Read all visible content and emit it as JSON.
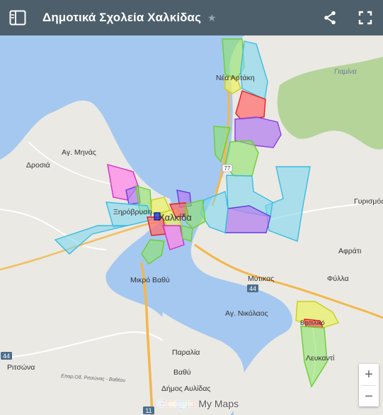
{
  "header": {
    "title": "Δημοτικά Σχολεία Χαλκίδας",
    "menu_icon": "side-panel-icon",
    "star_icon": "star-icon",
    "share_icon": "share-icon",
    "fullscreen_icon": "fullscreen-icon"
  },
  "map": {
    "labels": {
      "nea_artaki": "Νέα Αρτάκη",
      "giamina": "Γιαμίνα",
      "ag_minas": "Αγ. Μηνάς",
      "drosia": "Δροσιά",
      "gyrismos": "Γυρισμός",
      "xirovrysi": "Ξηρόβρυση",
      "chalkida": "Χαλκίδα",
      "afrati": "Αφράτι",
      "mytikas": "Μύτικας",
      "fylla": "Φύλλα",
      "mikro_vathy": "Μικρό Βαθύ",
      "ag_nikolaos": "Αγ. Νικόλαος",
      "vasiliko": "Βασιλικό",
      "paralia": "Παραλία",
      "ritsona": "Ριτσώνα",
      "vathy": "Βαθύ",
      "lefkanti": "Λευκαντί",
      "dimos_avlidas": "Δήμος Αυλίδας",
      "road_label": "Επαρ.Οδ. Ριτσώνας - Βαθέου"
    },
    "road_shields": {
      "r44_east": "44",
      "r44_west": "44",
      "r77": "77",
      "r11": "11"
    }
  },
  "controls": {
    "zoom_in": "+",
    "zoom_out": "−"
  },
  "branding": {
    "google": "Google",
    "my_maps": "My Maps"
  },
  "colors": {
    "header_bg": "#4d5f6b",
    "water": "#a5c8f0",
    "land": "#ebe9e4",
    "green_area": "#b5d49a",
    "road_major": "#f4b74a"
  }
}
